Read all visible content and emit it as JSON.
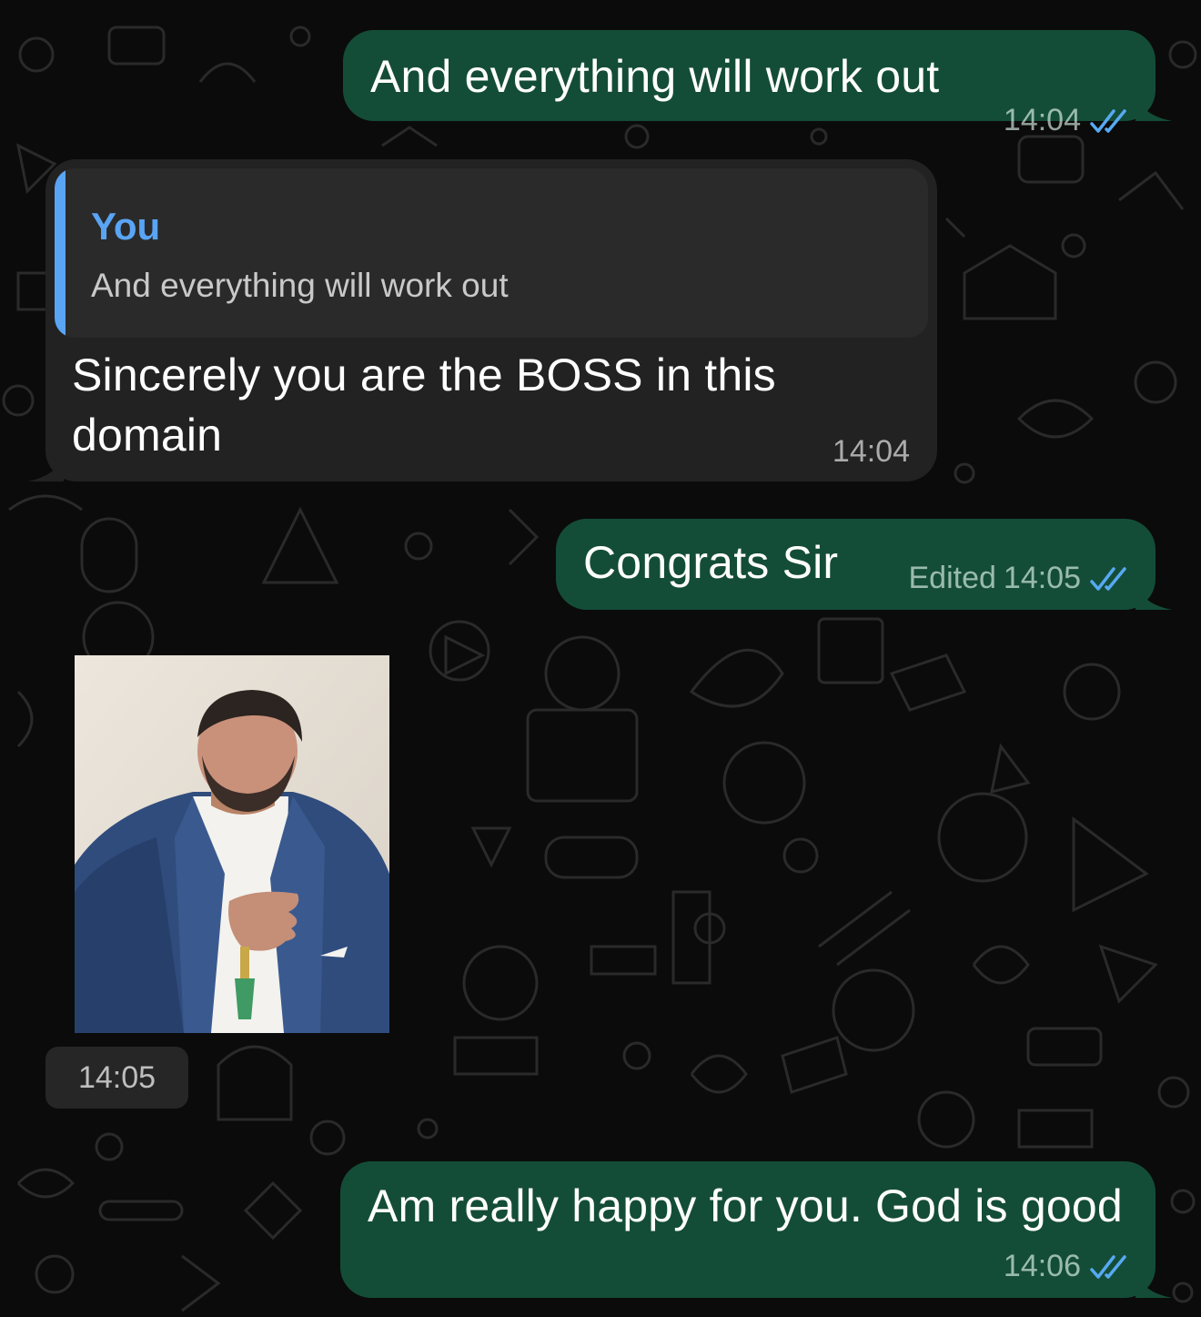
{
  "chat": {
    "colors": {
      "background": "#0b0b0b",
      "outgoing_bubble": "#144d37",
      "incoming_bubble": "#222222",
      "quote_accent": "#5aa4f4",
      "read_ticks": "#57a9f2"
    },
    "messages": [
      {
        "direction": "outgoing",
        "text": "And everything will work out",
        "time": "14:04",
        "status_icon": "double-check-read-icon"
      },
      {
        "direction": "incoming",
        "quote": {
          "author": "You",
          "text": "And everything will work out"
        },
        "text": "Sincerely you are the BOSS in this domain",
        "time": "14:04"
      },
      {
        "direction": "outgoing",
        "text": "Congrats Sir",
        "edited_label": "Edited",
        "time": "14:05",
        "status_icon": "double-check-read-icon"
      },
      {
        "direction": "incoming",
        "type": "photo",
        "photo_subject": "man in blue blazer with hand on chest",
        "time": "14:05"
      },
      {
        "direction": "outgoing",
        "text": "Am really happy for you. God is good",
        "time": "14:06",
        "status_icon": "double-check-read-icon"
      }
    ]
  }
}
